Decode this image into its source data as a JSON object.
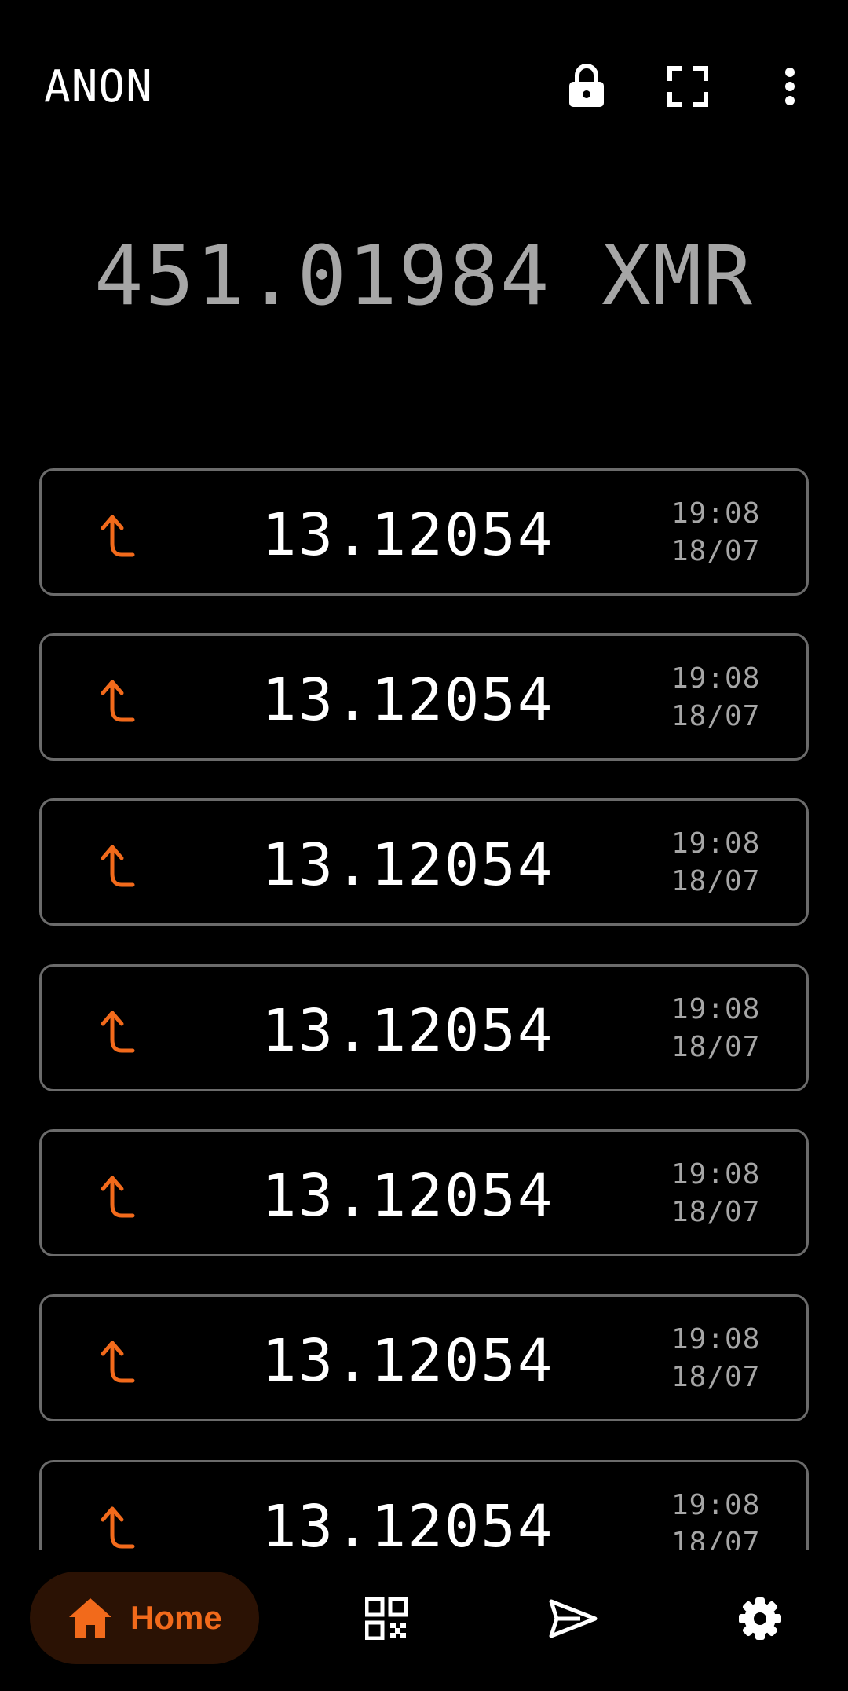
{
  "header": {
    "wallet_name": "ANON",
    "icons": [
      "lock-icon",
      "fullscreen-icon",
      "more-vert-icon"
    ]
  },
  "balance": {
    "text": "451.01984 XMR"
  },
  "transactions": [
    {
      "direction": "outgoing",
      "amount": "13.12054",
      "time": "19:08",
      "date": "18/07"
    },
    {
      "direction": "outgoing",
      "amount": "13.12054",
      "time": "19:08",
      "date": "18/07"
    },
    {
      "direction": "outgoing",
      "amount": "13.12054",
      "time": "19:08",
      "date": "18/07"
    },
    {
      "direction": "outgoing",
      "amount": "13.12054",
      "time": "19:08",
      "date": "18/07"
    },
    {
      "direction": "outgoing",
      "amount": "13.12054",
      "time": "19:08",
      "date": "18/07"
    },
    {
      "direction": "outgoing",
      "amount": "13.12054",
      "time": "19:08",
      "date": "18/07"
    },
    {
      "direction": "outgoing",
      "amount": "13.12054",
      "time": "19:08",
      "date": "18/07"
    }
  ],
  "nav": {
    "home_label": "Home",
    "items": [
      "home-icon",
      "qr-code-icon",
      "send-icon",
      "settings-icon"
    ]
  },
  "colors": {
    "background": "#000000",
    "accent": "#f26a1b",
    "balance_text": "#a6a6a6",
    "card_border": "#6b6b6b",
    "home_pill": "#2b1204"
  }
}
